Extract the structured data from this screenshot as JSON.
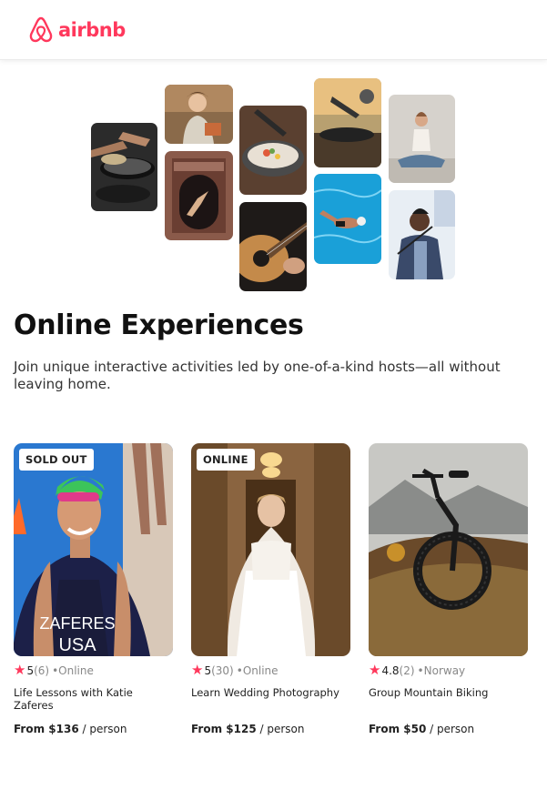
{
  "brand": {
    "name": "airbnb",
    "color": "#ff385c"
  },
  "hero": {
    "title": "Online Experiences",
    "subtitle": "Join unique interactive activities led by one-of-a-kind hosts—all without leaving home."
  },
  "collage": [
    "cooking-pans",
    "woman-portrait",
    "dancer-doorway",
    "food-bowl",
    "guitar",
    "record-player",
    "swimmer",
    "yoga",
    "singer"
  ],
  "cards": [
    {
      "badge": "SOLD OUT",
      "star": "★",
      "rating": "5",
      "reviews": "(6)",
      "location": "•Online",
      "title": "Life Lessons with Katie Zaferes",
      "price_label": "From $136",
      "per": " / person",
      "jersey_line1": "ZAFERES",
      "jersey_line2": "USA"
    },
    {
      "badge": "ONLINE",
      "star": "★",
      "rating": "5",
      "reviews": "(30)",
      "location": "•Online",
      "title": "Learn Wedding Photography",
      "price_label": "From $125",
      "per": " / person"
    },
    {
      "badge": "",
      "star": "★",
      "rating": "4.8",
      "reviews": "(2)",
      "location": "•Norway",
      "title": "Group Mountain Biking",
      "price_label": "From $50",
      "per": " / person"
    }
  ]
}
